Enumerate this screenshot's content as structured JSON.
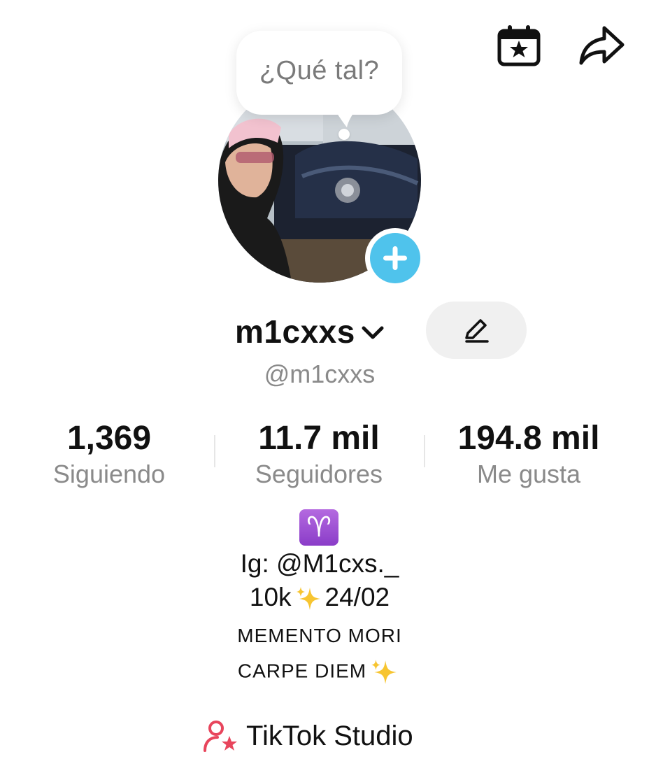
{
  "header": {
    "calendar_icon": "calendar-star-icon",
    "share_icon": "share-arrow-icon"
  },
  "note_bubble": {
    "text": "¿Qué tal?"
  },
  "profile": {
    "display_name": "m1cxxs",
    "handle": "@m1cxxs",
    "add_story_icon": "plus-icon",
    "edit_icon": "pencil-icon"
  },
  "stats": [
    {
      "value": "1,369",
      "label": "Siguiendo"
    },
    {
      "value": "11.7 mil",
      "label": "Seguidores"
    },
    {
      "value": "194.8 mil",
      "label": "Me gusta"
    }
  ],
  "bio": {
    "zodiac_emoji": "♈",
    "line1": "Ig: @M1cxs._",
    "line2_text": "10k",
    "line2_date": "24/02",
    "line3": "MEMENTO MORI",
    "line4": "CARPE DIEM"
  },
  "studio": {
    "label": "TikTok Studio",
    "icon": "creator-studio-icon"
  },
  "colors": {
    "accent_blue": "#4fc3ec",
    "studio_red": "#e8455c",
    "edit_bg": "#f0f0f0",
    "muted_text": "#8a8a8a",
    "aries_purple": "#9b4fd6"
  }
}
